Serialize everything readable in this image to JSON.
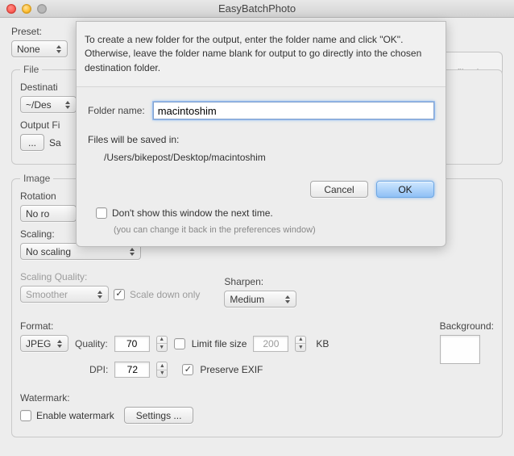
{
  "window": {
    "title": "EasyBatchPhoto"
  },
  "drop": {
    "label": "op files here"
  },
  "preset": {
    "label": "Preset:",
    "value": "None"
  },
  "file": {
    "legend": "File",
    "destination_label": "Destinati",
    "destination_value": "~/Des",
    "output_label": "Output Fi",
    "output_btn": "...",
    "output_tail": "Sa"
  },
  "image": {
    "legend": "Image",
    "rotation_label": "Rotation",
    "rotation_value": "No ro",
    "scaling_label": "Scaling:",
    "scaling_value": "No scaling",
    "scaling_quality_label": "Scaling Quality:",
    "scaling_quality_value": "Smoother",
    "scale_down_only": "Scale down only",
    "sharpen_label": "Sharpen:",
    "sharpen_value": "Medium",
    "format_label": "Format:",
    "format_value": "JPEG",
    "quality_label": "Quality:",
    "quality_value": "70",
    "dpi_label": "DPI:",
    "dpi_value": "72",
    "limit_label": "Limit file size",
    "limit_value": "200",
    "limit_unit": "KB",
    "preserve_label": "Preserve EXIF",
    "background_label": "Background:",
    "watermark_label": "Watermark:",
    "enable_watermark": "Enable watermark",
    "settings_btn": "Settings ..."
  },
  "sheet": {
    "hint": "To create a new folder for the output, enter the folder name and click \"OK\".  Otherwise, leave the folder name blank for output to go directly into the chosen destination folder.",
    "folder_label": "Folder name:",
    "folder_value": "macintoshim",
    "saved_in_label": "Files will be saved in:",
    "saved_in_path": "/Users/bikepost/Desktop/macintoshim",
    "cancel": "Cancel",
    "ok": "OK",
    "dont_show": "Don't show this window the next time.",
    "dont_show_sub": "(you can change it back in the preferences window)"
  }
}
